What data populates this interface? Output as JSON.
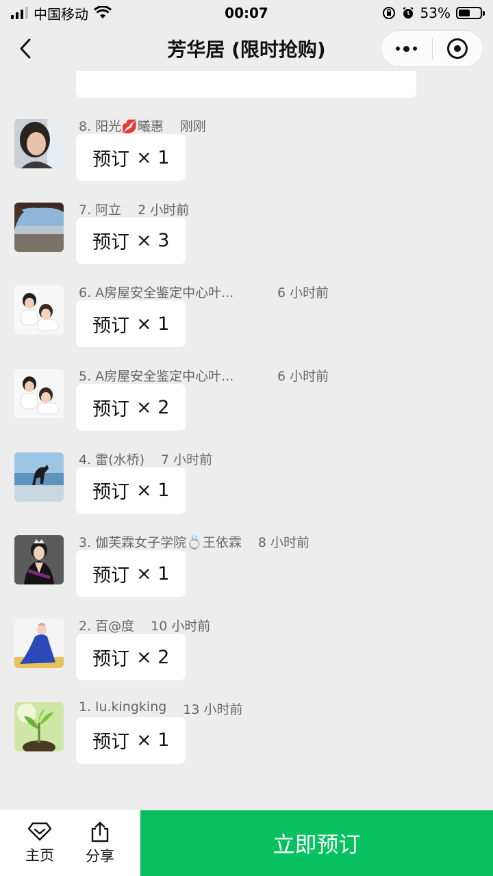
{
  "status_bar": {
    "carrier": "中国移动",
    "time": "00:07",
    "battery_percent": "53%",
    "battery_level": 0.53
  },
  "nav": {
    "title": "芳华居 (限时抢购)"
  },
  "orders": [
    {
      "name": "8. 阳光💋曦惠",
      "time": "刚刚",
      "action": "预订",
      "qty": "× 1",
      "avatar": "avatar-woman-selfie"
    },
    {
      "name": "7. 阿立",
      "time": "2 小时前",
      "action": "预订",
      "qty": "× 3",
      "avatar": "avatar-landscape"
    },
    {
      "name": "6. A房屋安全鉴定中心叶...",
      "time": "6 小时前",
      "action": "预订",
      "qty": "× 1",
      "avatar": "avatar-couple"
    },
    {
      "name": "5. A房屋安全鉴定中心叶...",
      "time": "6 小时前",
      "action": "预订",
      "qty": "× 2",
      "avatar": "avatar-couple"
    },
    {
      "name": "4. 雷(水桥)",
      "time": "7 小时前",
      "action": "预订",
      "qty": "× 1",
      "avatar": "avatar-horse-beach"
    },
    {
      "name": "3. 伽芙霖女子学院💍王依霖",
      "time": "8 小时前",
      "action": "预订",
      "qty": "× 1",
      "avatar": "avatar-woman-crown"
    },
    {
      "name": "2. 百@度",
      "time": "10 小时前",
      "action": "预订",
      "qty": "× 2",
      "avatar": "avatar-woman-blue-dress"
    },
    {
      "name": "1. lu.kingking",
      "time": "13 小时前",
      "action": "预订",
      "qty": "× 1",
      "avatar": "avatar-sprout"
    }
  ],
  "bottom_bar": {
    "home_label": "主页",
    "share_label": "分享",
    "cta_label": "立即预订",
    "cta_color": "#07c160"
  }
}
